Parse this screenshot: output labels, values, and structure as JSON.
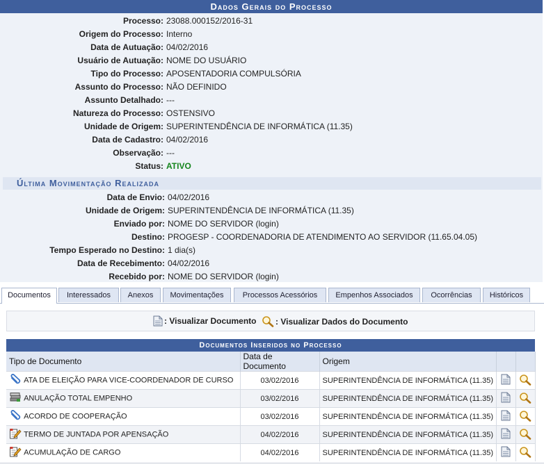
{
  "header": {
    "title": "Dados Gerais do Processo"
  },
  "process": [
    {
      "label": "Processo:",
      "value": "23088.000152/2016-31"
    },
    {
      "label": "Origem do Processo:",
      "value": "Interno"
    },
    {
      "label": "Data de Autuação:",
      "value": "04/02/2016"
    },
    {
      "label": "Usuário de Autuação:",
      "value": "NOME DO USUÁRIO"
    },
    {
      "label": "Tipo do Processo:",
      "value": "APOSENTADORIA COMPULSÓRIA"
    },
    {
      "label": "Assunto do Processo:",
      "value": "NÃO DEFINIDO"
    },
    {
      "label": "Assunto Detalhado:",
      "value": "---"
    },
    {
      "label": "Natureza do Processo:",
      "value": "OSTENSIVO"
    },
    {
      "label": "Unidade de Origem:",
      "value": "SUPERINTENDÊNCIA DE INFORMÁTICA (11.35)"
    },
    {
      "label": "Data de Cadastro:",
      "value": "04/02/2016"
    },
    {
      "label": "Observação:",
      "value": "---"
    },
    {
      "label": "Status:",
      "value": "ATIVO"
    }
  ],
  "movement": {
    "title": "Última Movimentação Realizada",
    "rows": [
      {
        "label": "Data de Envio:",
        "value": "04/02/2016"
      },
      {
        "label": "Unidade de Origem:",
        "value": "SUPERINTENDÊNCIA DE INFORMÁTICA (11.35)"
      },
      {
        "label": "Enviado por:",
        "value": "NOME DO SERVIDOR (login)"
      },
      {
        "label": "Destino:",
        "value": "PROGESP - COORDENADORIA DE ATENDIMENTO AO SERVIDOR (11.65.04.05)"
      },
      {
        "label": "Tempo Esperado no Destino:",
        "value": "1 dia(s)"
      },
      {
        "label": "Data de Recebimento:",
        "value": "04/02/2016"
      },
      {
        "label": "Recebido por:",
        "value": "NOME DO SERVIDOR (login)"
      }
    ]
  },
  "tabs": [
    "Documentos",
    "Interessados",
    "Anexos",
    "Movimentações",
    "Processos Acessórios",
    "Empenhos Associados",
    "Ocorrências",
    "Históricos"
  ],
  "legend": {
    "view_doc": ": Visualizar Documento",
    "view_data": ": Visualizar Dados do Documento"
  },
  "docs": {
    "title": "Documentos Inseridos no Processo",
    "headers": {
      "tipo": "Tipo de Documento",
      "data": "Data de Documento",
      "origem": "Origem"
    },
    "rows": [
      {
        "icon": "paperclip-icon",
        "tipo": "ATA DE ELEIÇÃO PARA VICE-COORDENADOR DE CURSO",
        "data": "03/02/2016",
        "origem": "SUPERINTENDÊNCIA DE INFORMÁTICA (11.35)"
      },
      {
        "icon": "stack-icon",
        "tipo": "ANULAÇÃO TOTAL EMPENHO",
        "data": "03/02/2016",
        "origem": "SUPERINTENDÊNCIA DE INFORMÁTICA (11.35)"
      },
      {
        "icon": "paperclip-icon",
        "tipo": "ACORDO DE COOPERAÇÃO",
        "data": "03/02/2016",
        "origem": "SUPERINTENDÊNCIA DE INFORMÁTICA (11.35)"
      },
      {
        "icon": "edit-document-icon",
        "tipo": "TERMO DE JUNTADA POR APENSAÇÃO",
        "data": "04/02/2016",
        "origem": "SUPERINTENDÊNCIA DE INFORMÁTICA (11.35)"
      },
      {
        "icon": "edit-document-icon",
        "tipo": "ACUMULAÇÃO DE CARGO",
        "data": "04/02/2016",
        "origem": "SUPERINTENDÊNCIA DE INFORMÁTICA (11.35)"
      }
    ]
  }
}
